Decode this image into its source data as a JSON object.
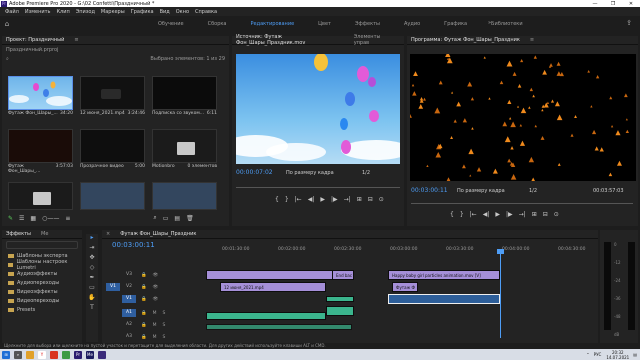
{
  "window": {
    "title": "Adobe Premiere Pro 2020 - G:\\02 Confetti\\Праздничный *",
    "controls": [
      "—",
      "❐",
      "✕"
    ]
  },
  "menu": [
    "Файл",
    "Изменить",
    "Клип",
    "Эпизод",
    "Маркеры",
    "Графика",
    "Вид",
    "Окно",
    "Справка"
  ],
  "workspaces": {
    "tabs": [
      "Обучение",
      "Сборка",
      "Редактирование",
      "Цвет",
      "Эффекты",
      "Аудио",
      "Графика",
      "Библиотеки"
    ],
    "active": 2,
    "more": "»"
  },
  "project": {
    "tab": "Проект: Праздничный",
    "menu": "≡",
    "file": "Праздничный.prproj",
    "selected": "Выбрано элементов: 1 из 29",
    "bins": [
      {
        "name": "Футаж Фон_Шары_...",
        "dur": "34:20"
      },
      {
        "name": "12 июня_2021.mp4",
        "dur": "3:24:46"
      },
      {
        "name": "Подписка со звуком...",
        "dur": "6:11"
      },
      {
        "name": "Футаж Фон_Шары_...",
        "dur": "3:57:03"
      },
      {
        "name": "Прозрачное видео",
        "dur": "5:00"
      },
      {
        "name": "Motionbro",
        "dur": "0 элементов"
      },
      {
        "name": "",
        "dur": ""
      },
      {
        "name": "",
        "dur": ""
      },
      {
        "name": "",
        "dur": ""
      }
    ]
  },
  "source": {
    "tabs": [
      "Источник: Футаж Фон_Шары_Праздник.mov",
      "Элементы управ"
    ],
    "tc_left": "00:00:07:02",
    "fit": "По размеру кадра",
    "ratio": "1/2",
    "tc_right": "00:00:34:20"
  },
  "program": {
    "tab": "Программа: Футаж Фон_Шары_Праздник",
    "menu": "≡",
    "tc_left": "00:03:00:11",
    "fit": "По размеру кадра",
    "ratio": "1/2",
    "tc_right": "00:03:57:03"
  },
  "transport": [
    "{",
    "}",
    "|←",
    "◀|",
    "▶",
    "|▶",
    "→|",
    "⊞",
    "⊟",
    "⊙"
  ],
  "effects": {
    "tabs": [
      "Эффекты",
      "Ме"
    ],
    "items": [
      "Шаблоны эксперта",
      "Шаблоны настроек Lumetri",
      "Аудиоэффекты",
      "Аудиопереходы",
      "Видеоэффекты",
      "Видеопереходы",
      "Presets"
    ]
  },
  "tools": [
    "▸",
    "⇥",
    "✥",
    "◇",
    "✒",
    "▭",
    "✋",
    "T"
  ],
  "timeline": {
    "tab": "Футаж Фон_Шары_Праздник",
    "tc": "00:03:00:11",
    "ruler": [
      "00:01:30:00",
      "00:02:00:00",
      "00:02:30:00",
      "00:03:00:00",
      "00:03:30:00",
      "00:04:00:00",
      "00:04:30:00"
    ],
    "tracks": [
      "V3",
      "V2",
      "V1",
      "A1",
      "A2",
      "A3"
    ],
    "clips": [
      {
        "label": "",
        "track": 0
      },
      {
        "label": "End bac",
        "track": 0
      },
      {
        "label": "Happy baby girl particles animation.mov [V]",
        "track": 0
      },
      {
        "label": "12 июня_2021.mp4",
        "track": 1
      },
      {
        "label": "Футаж Ф",
        "track": 1
      },
      {
        "label": "",
        "track": 2
      },
      {
        "label": "",
        "track": 3
      },
      {
        "label": "",
        "track": 3
      },
      {
        "label": "",
        "track": 3
      },
      {
        "label": "",
        "track": 4
      }
    ]
  },
  "meters": {
    "labels": [
      "0",
      "-12",
      "-24",
      "-36",
      "-48",
      "dB"
    ]
  },
  "status": "Щелкните для выбора или щелкните на пустой участок и перетащите для выделения области. Для других действий используйте клавиши ALT и CMD.",
  "taskbar": {
    "lang": "РУС",
    "time": "20:32",
    "date": "14.07.2021"
  },
  "colors": {
    "accent": "#4e9df5",
    "video_clip": "#a58fd8",
    "audio_clip": "#3bb58d",
    "bg": "#1d1d1d"
  }
}
